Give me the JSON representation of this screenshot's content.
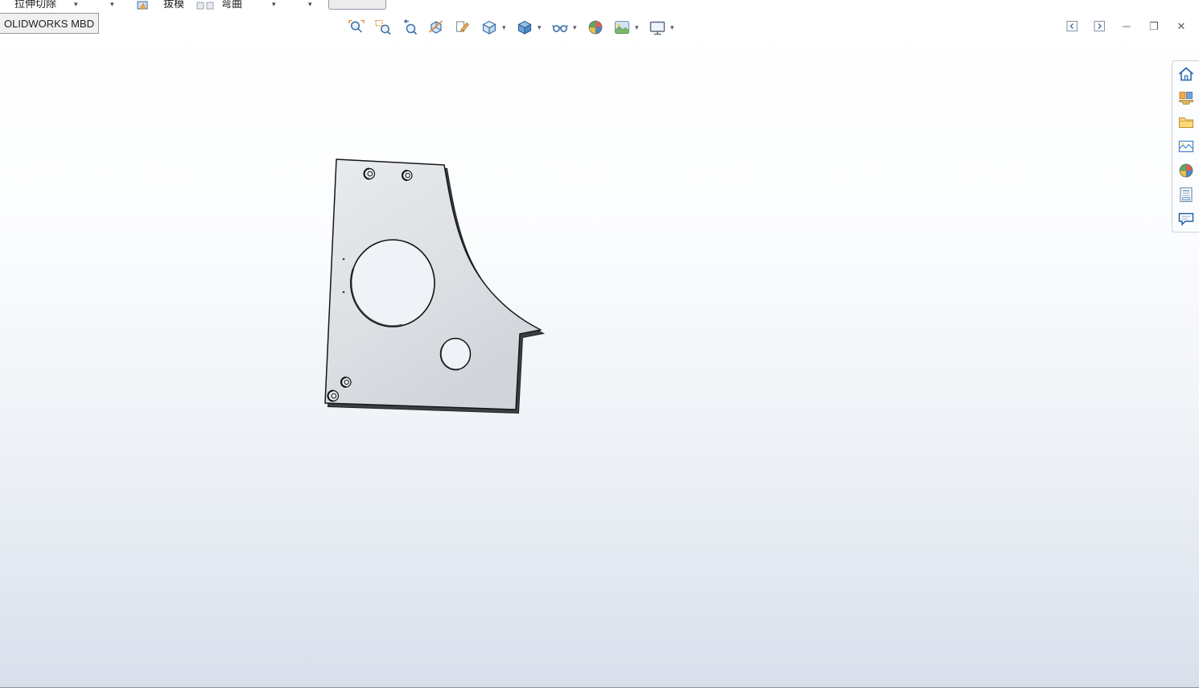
{
  "command_manager": {
    "labels": [
      "拉伸切除",
      "拔模",
      "弯曲"
    ],
    "caret": "▾",
    "tab_label": "OLIDWORKS MBD"
  },
  "headsup_toolbar": {
    "caret": "▾",
    "items": [
      "zoom-to-fit",
      "zoom-to-area",
      "previous-view",
      "section-view",
      "3d-drawing-view",
      "view-orientation",
      "display-style",
      "hide-show-items",
      "edit-appearance",
      "apply-scene",
      "view-settings"
    ]
  },
  "window_controls": {
    "minimize": "─",
    "restore": "❐",
    "close": "✕"
  },
  "task_pane": {
    "items": [
      "home",
      "design-library",
      "file-explorer",
      "view-palette",
      "appearances",
      "custom-properties",
      "solidworks-forum"
    ]
  },
  "status_bar": {
    "text": ""
  },
  "colors": {
    "viewport_top": "#ffffff",
    "viewport_bottom": "#d8dfeb",
    "part_fill": "#dadde1",
    "part_edge": "#17191c",
    "accent_blue": "#3a6ea8",
    "accent_orange": "#e0892e"
  }
}
